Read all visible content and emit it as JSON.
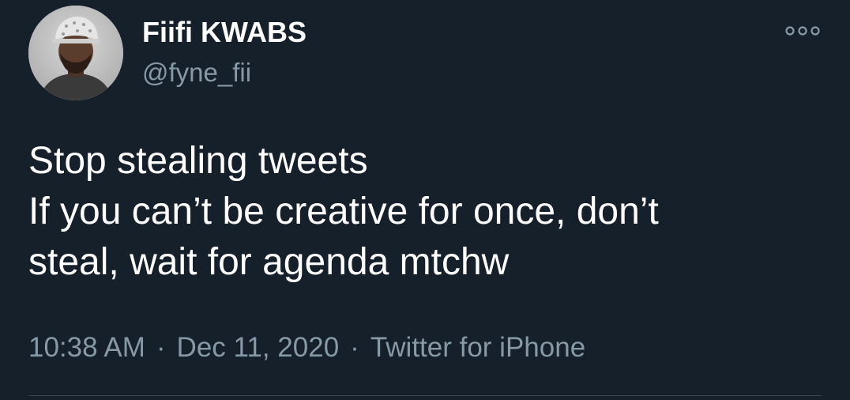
{
  "user": {
    "display_name": "Fiifi KWABS",
    "handle": "@fyne_fii",
    "avatar_icon": "profile-photo"
  },
  "tweet": {
    "lines": [
      "Stop stealing tweets",
      "If you can’t be creative for once, don’t",
      "steal, wait for agenda mtchw"
    ],
    "time": "10:38 AM",
    "separator": "·",
    "date": "Dec 11, 2020",
    "source": "Twitter for iPhone"
  },
  "icons": {
    "more": "more-options-icon"
  },
  "colors": {
    "background": "#15202b",
    "text_primary": "#ffffff",
    "text_secondary": "#8899a6",
    "divider": "#38444d"
  }
}
